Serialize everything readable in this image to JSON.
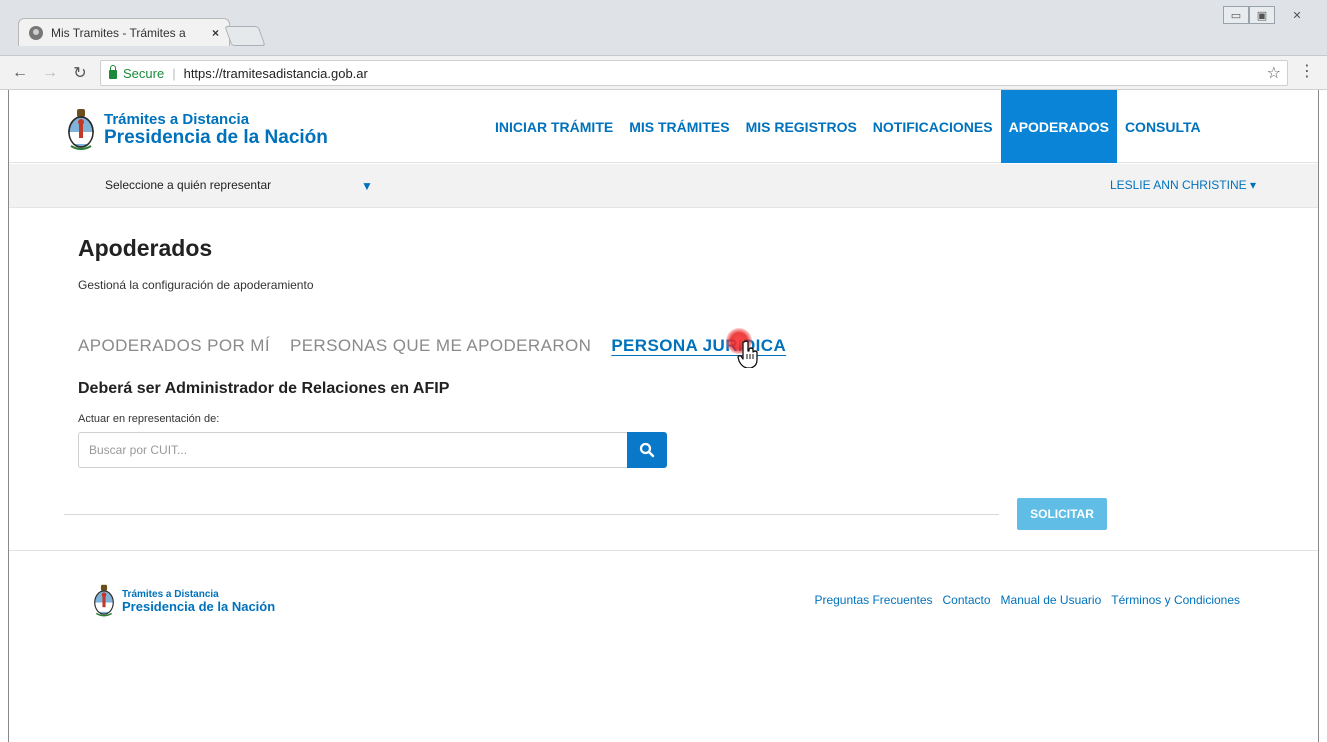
{
  "browser": {
    "tab_title": "Mis Tramites - Trámites a",
    "tab_close": "×",
    "secure_label": "Secure",
    "url": "https://tramitesadistancia.gob.ar"
  },
  "header": {
    "brand_top": "Trámites a Distancia",
    "brand_bottom": "Presidencia de la Nación",
    "nav": [
      {
        "label": "INICIAR TRÁMITE",
        "active": false
      },
      {
        "label": "MIS TRÁMITES",
        "active": false
      },
      {
        "label": "MIS REGISTROS",
        "active": false
      },
      {
        "label": "NOTIFICACIONES",
        "active": false
      },
      {
        "label": "APODERADOS",
        "active": true
      },
      {
        "label": "CONSULTA",
        "active": false
      }
    ]
  },
  "subbar": {
    "represent_label": "Seleccione a quién representar",
    "user_name": "LESLIE ANN CHRISTINE ▾"
  },
  "main": {
    "title": "Apoderados",
    "subtitle": "Gestioná la configuración de apoderamiento",
    "tabs": [
      {
        "label": "APODERADOS POR MÍ",
        "active": false
      },
      {
        "label": "PERSONAS QUE ME APODERARON",
        "active": false
      },
      {
        "label": "PERSONA JURIDICA",
        "active": true
      }
    ],
    "section_title": "Deberá ser Administrador de Relaciones en AFIP",
    "field_label": "Actuar en representación de:",
    "search_placeholder": "Buscar por CUIT...",
    "submit_label": "SOLICITAR"
  },
  "footer": {
    "brand_top": "Trámites a Distancia",
    "brand_bottom": "Presidencia de la Nación",
    "links": [
      "Preguntas Frecuentes",
      "Contacto",
      "Manual de Usuario",
      "Términos y Condiciones"
    ]
  },
  "colors": {
    "brand_blue": "#0072bc",
    "active_nav": "#0a84d6",
    "search_button": "#0a78c8",
    "submit_button": "#5fbde6",
    "secure_green": "#1a8a3a"
  },
  "icons": [
    "back-arrow-icon",
    "forward-arrow-icon",
    "reload-icon",
    "lock-icon",
    "star-icon",
    "menu-dots-icon",
    "search-icon",
    "caret-down-icon",
    "seal-icon",
    "hand-cursor-icon"
  ]
}
